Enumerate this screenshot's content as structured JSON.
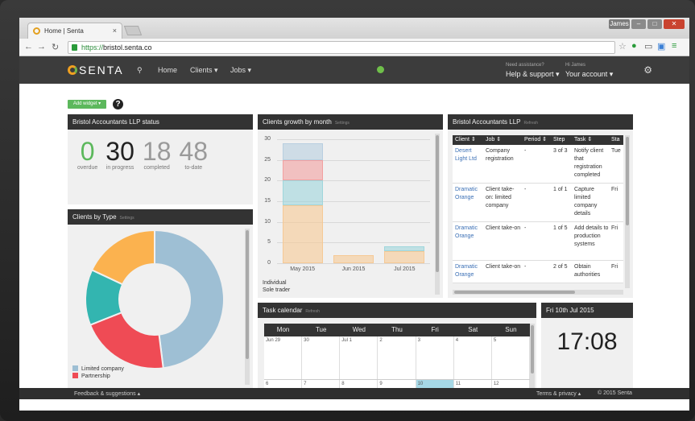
{
  "browser": {
    "tab_title": "Home | Senta",
    "tab_close": "×",
    "window_user_label": "James",
    "url_scheme": "https://",
    "url_host": "bristol.senta.co"
  },
  "app": {
    "logo": "SENTA",
    "nav": {
      "home": "Home",
      "clients": "Clients ▾",
      "jobs": "Jobs ▾"
    },
    "help_small": "Need assistance?",
    "help": "Help & support ▾",
    "account_small": "Hi James",
    "account": "Your account ▾"
  },
  "dashboard": {
    "add_widget": "Add widget ▾",
    "help_icon": "?",
    "status_widget": {
      "title": "Bristol Accountants LLP status",
      "stats": [
        {
          "value": "0",
          "label": "overdue",
          "color": "#5cb85c"
        },
        {
          "value": "30",
          "label": "in progress",
          "color": "#222222"
        },
        {
          "value": "18",
          "label": "completed",
          "color": "#9a9a9a"
        },
        {
          "value": "48",
          "label": "to-date",
          "color": "#9a9a9a"
        }
      ]
    },
    "growth_widget": {
      "title": "Clients growth by month",
      "subtitle": "Settings"
    },
    "type_widget": {
      "title": "Clients by Type",
      "subtitle": "Settings"
    },
    "jobs_widget": {
      "title": "Bristol Accountants LLP",
      "subtitle": "Refresh",
      "columns": [
        "Client ⇕",
        "Job ⇕",
        "Period ⇕",
        "Step",
        "Task ⇕",
        "Sta"
      ],
      "rows": [
        {
          "client": "Desert Light Ltd",
          "job": "Company registration",
          "period": "-",
          "step": "3 of 3",
          "task": "Notify client that registration completed",
          "status": "Tue"
        },
        {
          "client": "Dramatic Orange",
          "job": "Client take-on: limited company",
          "period": "-",
          "step": "1 of 1",
          "task": "Capture limited company details",
          "status": "Fri"
        },
        {
          "client": "Dramatic Orange",
          "job": "Client take-on",
          "period": "-",
          "step": "1 of 5",
          "task": "Add details to production systems",
          "status": "Fri"
        },
        {
          "client": "Dramatic Orange",
          "job": "Client take-on",
          "period": "-",
          "step": "2 of 5",
          "task": "Obtain authorities",
          "status": "Fri"
        }
      ]
    },
    "calendar_widget": {
      "title": "Task calendar",
      "subtitle": "Refresh",
      "days": [
        "Mon",
        "Tue",
        "Wed",
        "Thu",
        "Fri",
        "Sat",
        "Sun"
      ],
      "week1": [
        "Jun 29",
        "30",
        "Jul 1",
        "2",
        "3",
        "4",
        "5"
      ],
      "week2": [
        "6",
        "7",
        "8",
        "9",
        "10",
        "11",
        "12"
      ]
    },
    "clock_widget": {
      "date": "Fri 10th Jul 2015",
      "time": "17:08"
    },
    "footer": {
      "feedback": "Feedback & suggestions ▴",
      "terms": "Terms & privacy ▴",
      "copyright": "© 2015 Senta"
    }
  },
  "chart_data": [
    {
      "type": "bar",
      "title": "Clients growth by month",
      "categories": [
        "May 2015",
        "Jun 2015",
        "Jul 2015"
      ],
      "ylim": [
        0,
        30
      ],
      "yticks": [
        0,
        5,
        10,
        15,
        20,
        25,
        30
      ],
      "series": [
        {
          "name": "Individual",
          "values": [
            14,
            2,
            3
          ],
          "color": "#f6c995"
        },
        {
          "name": "Sole trader",
          "values": [
            6,
            0,
            1
          ],
          "color": "#9fd6dc"
        },
        {
          "name": "",
          "values": [
            5,
            0,
            0
          ],
          "color": "#f2a0a0"
        },
        {
          "name": "",
          "values": [
            4,
            0,
            0
          ],
          "color": "#b8cee0"
        }
      ]
    },
    {
      "type": "pie",
      "title": "Clients by Type",
      "slices": [
        {
          "label": "Limited company",
          "value": 48,
          "color": "#9ebfd4"
        },
        {
          "label": "Partnership",
          "value": 21,
          "color": "#ef4b55"
        },
        {
          "label": "",
          "value": 13,
          "color": "#33b5b0"
        },
        {
          "label": "",
          "value": 18,
          "color": "#fbb24f"
        }
      ]
    }
  ]
}
